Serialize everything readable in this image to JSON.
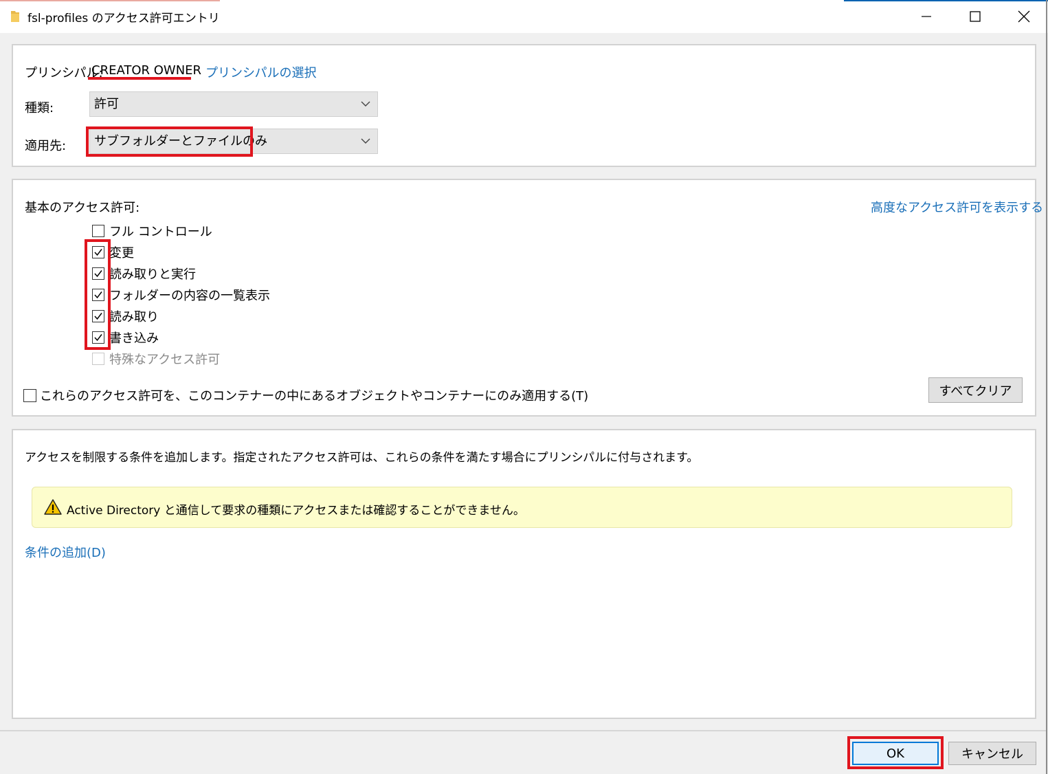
{
  "window": {
    "title": "fsl-profiles のアクセス許可エントリ"
  },
  "principal": {
    "label": "プリンシパル:",
    "value": "CREATOR OWNER",
    "select_link": "プリンシパルの選択"
  },
  "type_field": {
    "label": "種類:",
    "value": "許可"
  },
  "applies_to": {
    "label": "適用先:",
    "value": "サブフォルダーとファイルのみ"
  },
  "basic_permissions": {
    "label": "基本のアクセス許可:",
    "advanced_link": "高度なアクセス許可を表示する",
    "items": [
      {
        "label": "フル コントロール",
        "checked": false,
        "disabled": false
      },
      {
        "label": "変更",
        "checked": true,
        "disabled": false
      },
      {
        "label": "読み取りと実行",
        "checked": true,
        "disabled": false
      },
      {
        "label": "フォルダーの内容の一覧表示",
        "checked": true,
        "disabled": false
      },
      {
        "label": "読み取り",
        "checked": true,
        "disabled": false
      },
      {
        "label": "書き込み",
        "checked": true,
        "disabled": false
      },
      {
        "label": "特殊なアクセス許可",
        "checked": false,
        "disabled": true
      }
    ],
    "apply_only_label": "これらのアクセス許可を、このコンテナーの中にあるオブジェクトやコンテナーにのみ適用する(T)",
    "apply_only_checked": false,
    "clear_all_button": "すべてクリア"
  },
  "conditions": {
    "description": "アクセスを制限する条件を追加します。指定されたアクセス許可は、これらの条件を満たす場合にプリンシパルに付与されます。",
    "warning": "Active Directory と通信して要求の種類にアクセスまたは確認することができません。",
    "add_link": "条件の追加(D)"
  },
  "footer": {
    "ok_button": "OK",
    "cancel_button": "キャンセル"
  },
  "colors": {
    "link": "#1a6fb8",
    "highlight_red": "#e0151e",
    "warning_bg": "#fdfdcc"
  }
}
